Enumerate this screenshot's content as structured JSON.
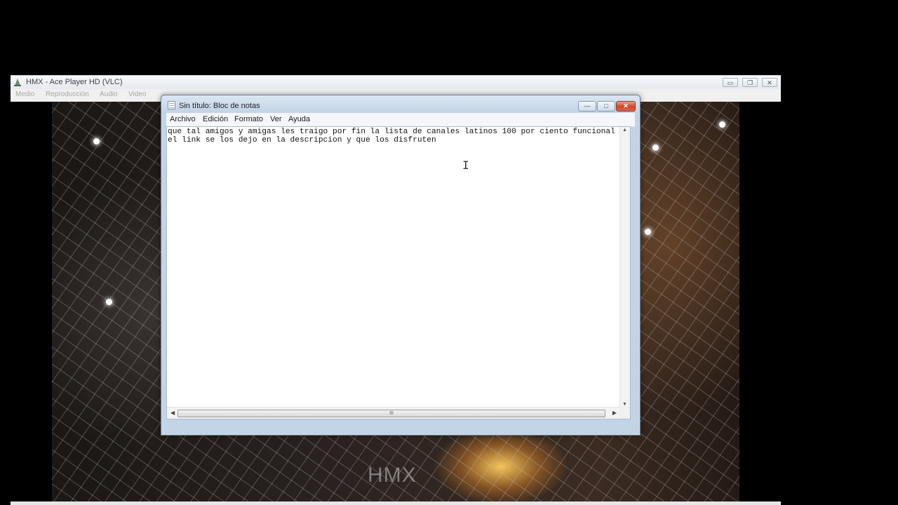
{
  "player": {
    "title": "HMX - Ace Player HD (VLC)",
    "menu": [
      "Medio",
      "Reproducción",
      "Audio",
      "Video"
    ],
    "minimize": "▭",
    "restore": "❐",
    "close": "✕",
    "watermark": "HMX"
  },
  "notepad": {
    "title": "Sin título: Bloc de notas",
    "menu": [
      "Archivo",
      "Edición",
      "Formato",
      "Ver",
      "Ayuda"
    ],
    "minimize": "—",
    "maximize": "□",
    "close": "✕",
    "text": "que tal amigos y amigas les traigo por fin la lista de canales latinos 100 por ciento funcional\nel link se los dejo en la descripcion y que los disfruten",
    "scroll_grip": "III"
  },
  "colors": {
    "close_button": "#c8482c",
    "titlebar": "#c2d3e6"
  }
}
